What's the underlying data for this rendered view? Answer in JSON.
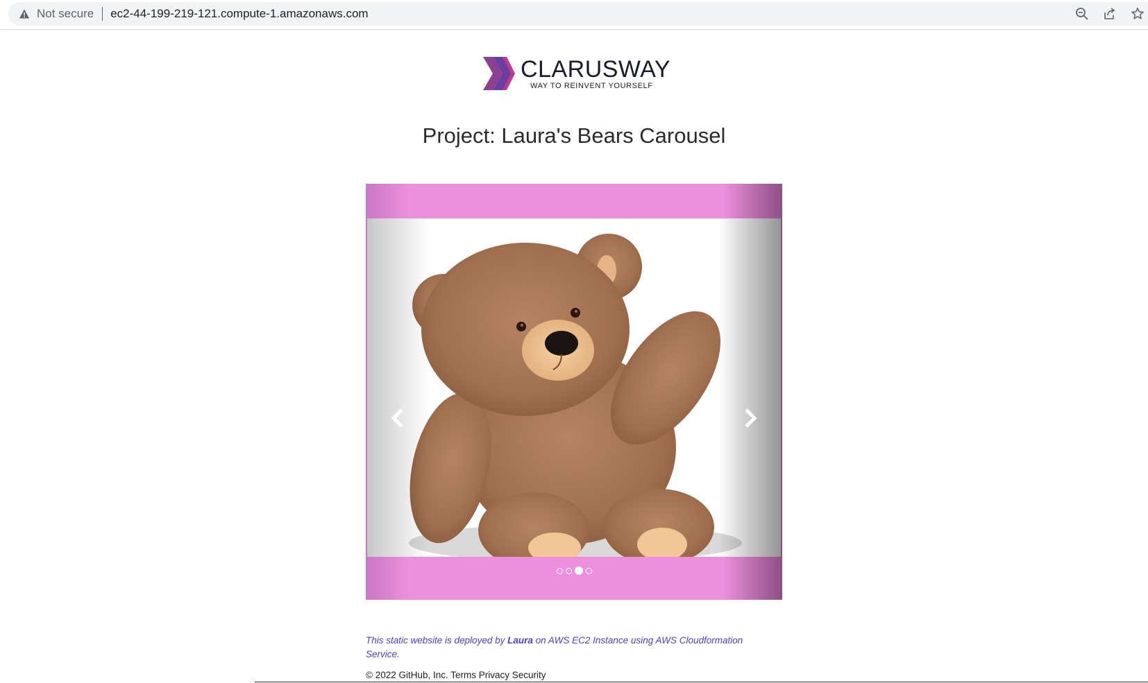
{
  "browser": {
    "security_label": "Not secure",
    "url": "ec2-44-199-219-121.compute-1.amazonaws.com",
    "icons": [
      "warning-icon",
      "zoom-icon",
      "share-icon",
      "bookmark-star-icon"
    ]
  },
  "logo": {
    "wordmark": "CLARUSWAY",
    "tagline": "WAY TO REINVENT YOURSELF"
  },
  "page": {
    "title": "Project: Laura's Bears Carousel"
  },
  "carousel": {
    "slide_count": 4,
    "active_index": 2,
    "slide_alt": "Teddy bear",
    "frame_color": "#ec8fdc",
    "prev_icon": "chevron-left-icon",
    "next_icon": "chevron-right-icon"
  },
  "footer": {
    "note_prefix": "This static website is deployed by ",
    "note_author": "Laura",
    "note_suffix": " on AWS EC2 Instance using AWS Cloudformation Service.",
    "copyright": "© 2022 GitHub, Inc. Terms Privacy Security",
    "link_color": "#4a3ee8"
  }
}
